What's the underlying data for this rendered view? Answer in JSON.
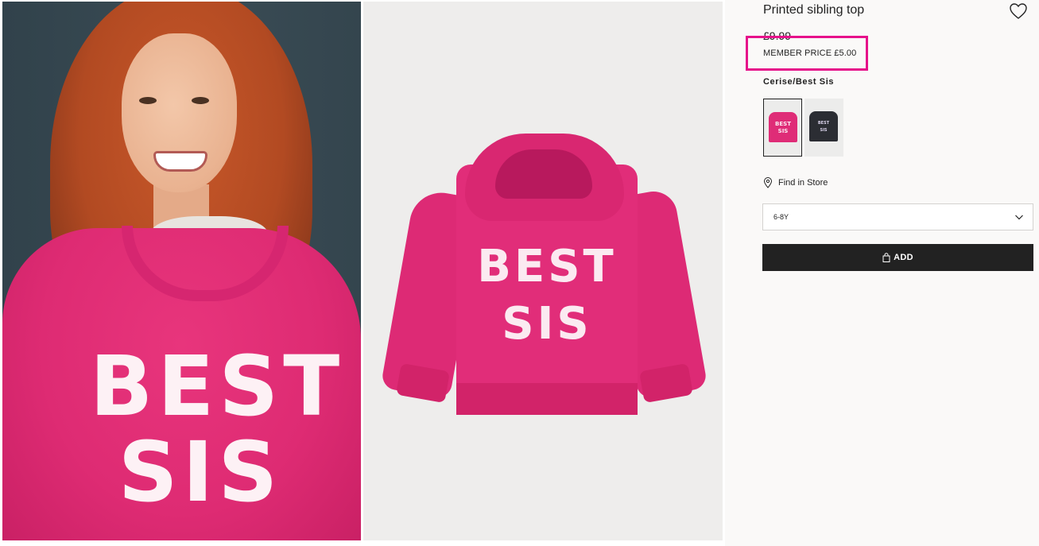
{
  "product": {
    "title": "Printed sibling top",
    "price": "£9.99",
    "member_price": "MEMBER PRICE £5.00",
    "color_name": "Cerise/Best Sis"
  },
  "images": {
    "model_print_line1": "BEST",
    "model_print_line2": "SIS",
    "product_print_line1": "BEST",
    "product_print_line2": "SIS"
  },
  "swatches": [
    {
      "name": "Cerise/Best Sis",
      "print": "BEST SIS",
      "color": "#df2c77",
      "selected": true
    },
    {
      "name": "Black",
      "print": "BEST SIS",
      "color": "#2b2d33",
      "selected": false
    }
  ],
  "find_in_store": {
    "label": "Find in Store",
    "icon": "location-pin-icon"
  },
  "size_select": {
    "value": "6-8Y",
    "icon": "chevron-down-icon"
  },
  "add_button": {
    "label": "ADD",
    "icon": "bag-icon"
  },
  "favorite": {
    "icon": "heart-icon"
  },
  "colors": {
    "highlight": "#e6118a",
    "button_bg": "#222222",
    "hoodie": "#e12d79"
  }
}
